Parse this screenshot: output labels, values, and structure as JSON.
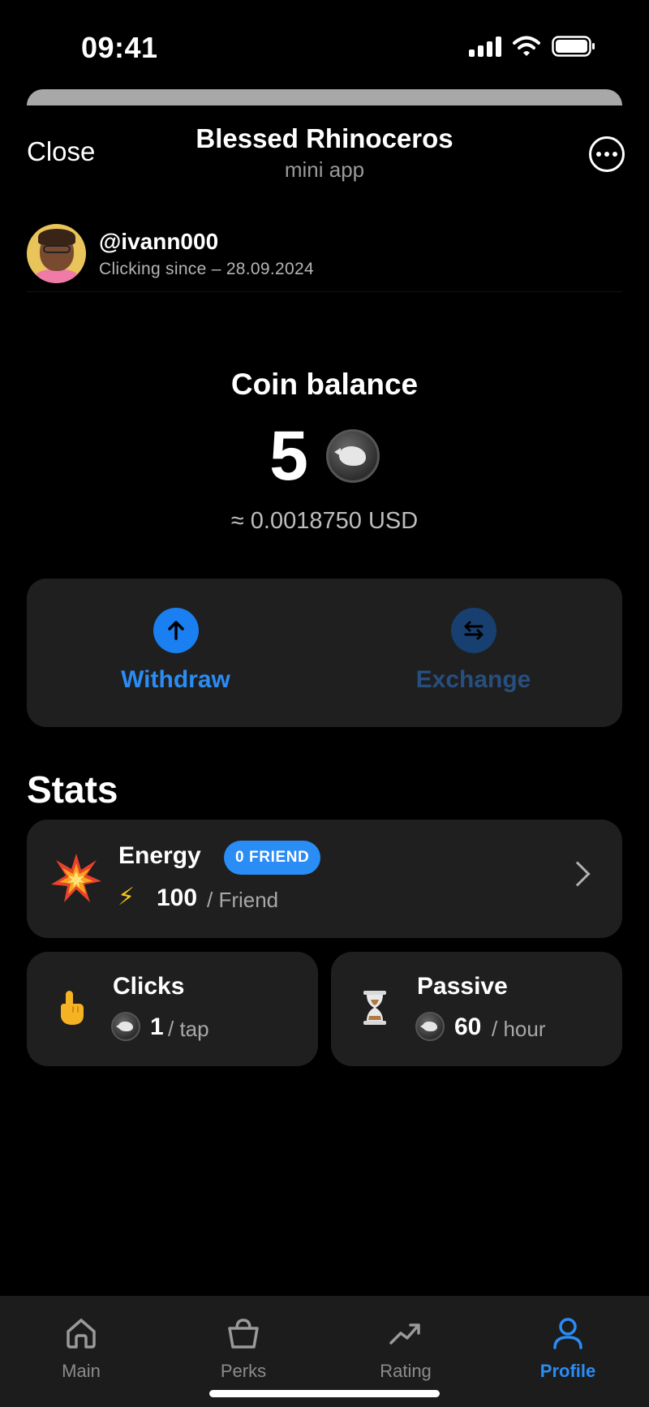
{
  "status_bar": {
    "time": "09:41"
  },
  "header": {
    "close_label": "Close",
    "title": "Blessed Rhinoceros",
    "subtitle": "mini app"
  },
  "profile": {
    "username": "@ivann000",
    "since": "Clicking since – 28.09.2024"
  },
  "balance": {
    "label": "Coin balance",
    "value": "5",
    "usd": "≈ 0.0018750 USD"
  },
  "actions": {
    "withdraw_label": "Withdraw",
    "exchange_label": "Exchange"
  },
  "stats": {
    "title": "Stats",
    "energy": {
      "name": "Energy",
      "badge": "0 FRIEND",
      "value": "100",
      "unit": "/ Friend"
    },
    "clicks": {
      "name": "Clicks",
      "value": "1",
      "unit": "/ tap"
    },
    "passive": {
      "name": "Passive",
      "value": "60",
      "unit": "/ hour"
    }
  },
  "nav": {
    "items": [
      {
        "label": "Main",
        "icon": "home-icon"
      },
      {
        "label": "Perks",
        "icon": "shopping-bag-icon"
      },
      {
        "label": "Rating",
        "icon": "trending-up-icon"
      },
      {
        "label": "Profile",
        "icon": "user-icon",
        "active": true
      }
    ]
  },
  "colors": {
    "accent": "#2a8cf5",
    "card": "#1f1f1f",
    "background": "#000000"
  }
}
